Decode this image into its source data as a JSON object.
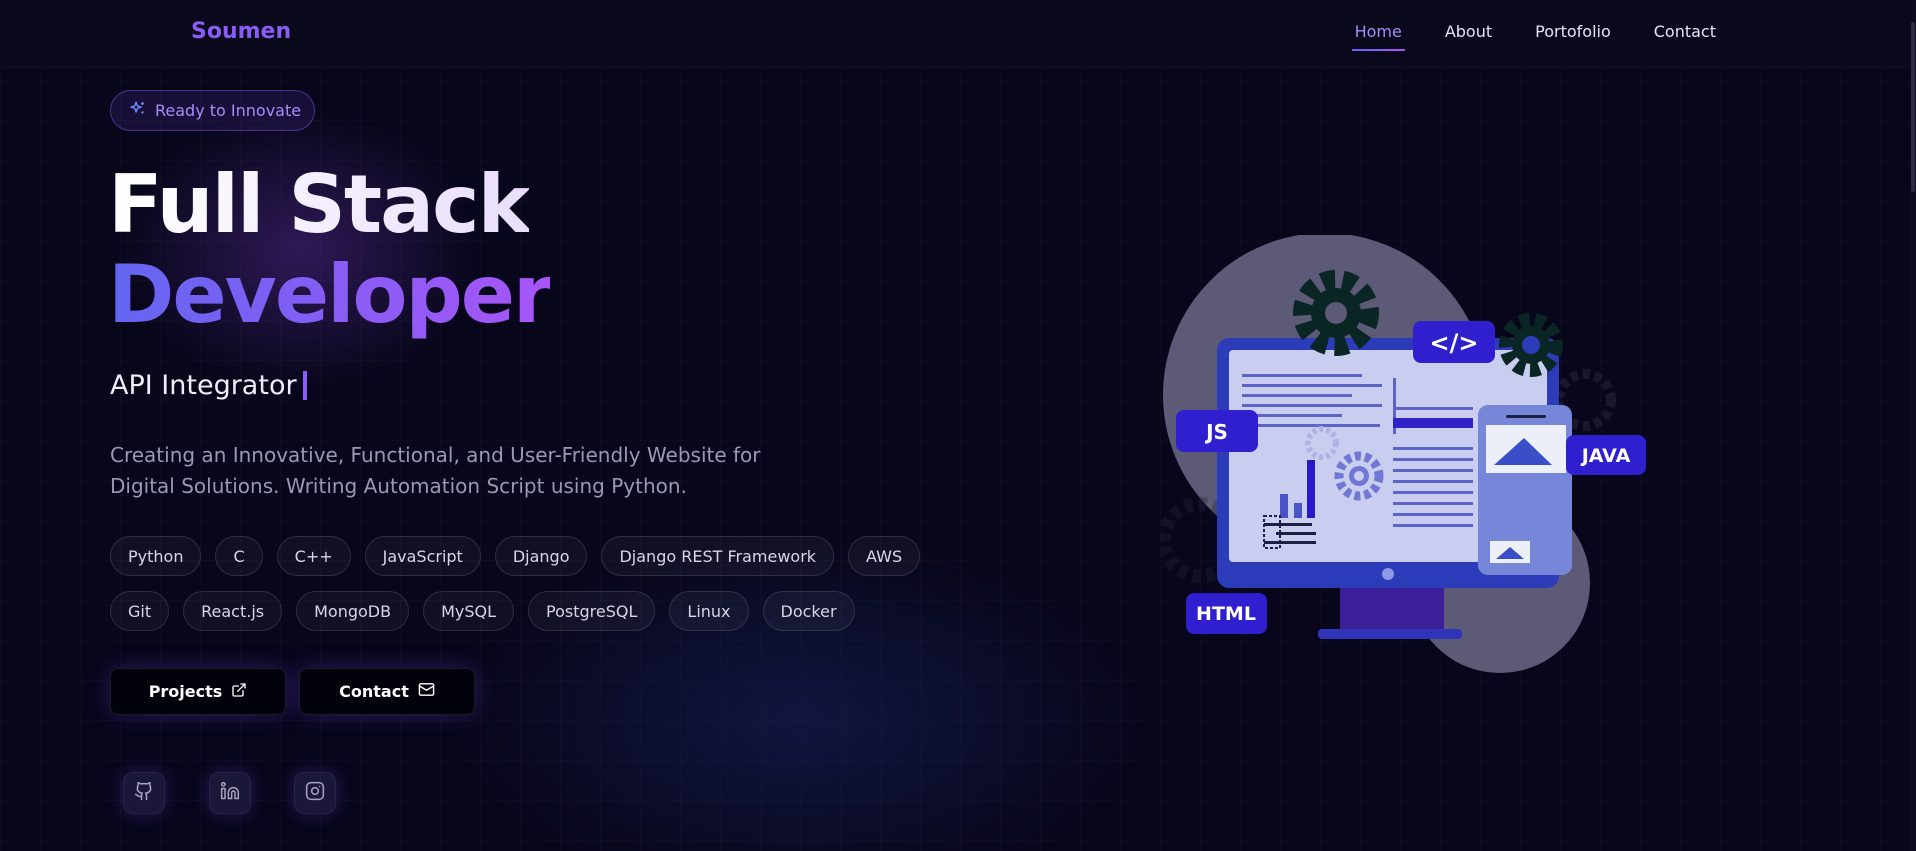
{
  "navbar": {
    "brand": "Soumen",
    "links": [
      {
        "label": "Home",
        "active": true
      },
      {
        "label": "About",
        "active": false
      },
      {
        "label": "Portofolio",
        "active": false
      },
      {
        "label": "Contact",
        "active": false
      }
    ]
  },
  "hero": {
    "badge": "Ready to Innovate",
    "title_line1": "Full Stack",
    "title_line2": "Developer",
    "role": "API Integrator",
    "description": "Creating an Innovative, Functional, and User-Friendly Website for Digital Solutions. Writing Automation Script using Python.",
    "skills": [
      "Python",
      "C",
      "C++",
      "JavaScript",
      "Django",
      "Django REST Framework",
      "AWS",
      "Git",
      "React.js",
      "MongoDB",
      "MySQL",
      "PostgreSQL",
      "Linux",
      "Docker"
    ],
    "buttons": {
      "projects": {
        "label": "Projects",
        "icon": "external-link-icon"
      },
      "contact": {
        "label": "Contact",
        "icon": "mail-icon"
      }
    },
    "social_icons": [
      "github-icon",
      "linkedin-icon",
      "instagram-icon"
    ]
  },
  "illustration": {
    "labels": {
      "js": "JS",
      "code": "</>",
      "java": "JAVA",
      "html": "HTML"
    }
  },
  "colors": {
    "accent": "#8b5cf6",
    "accent_gradient_start": "#6366f1",
    "accent_gradient_end": "#a855f7",
    "background": "#07061a"
  }
}
